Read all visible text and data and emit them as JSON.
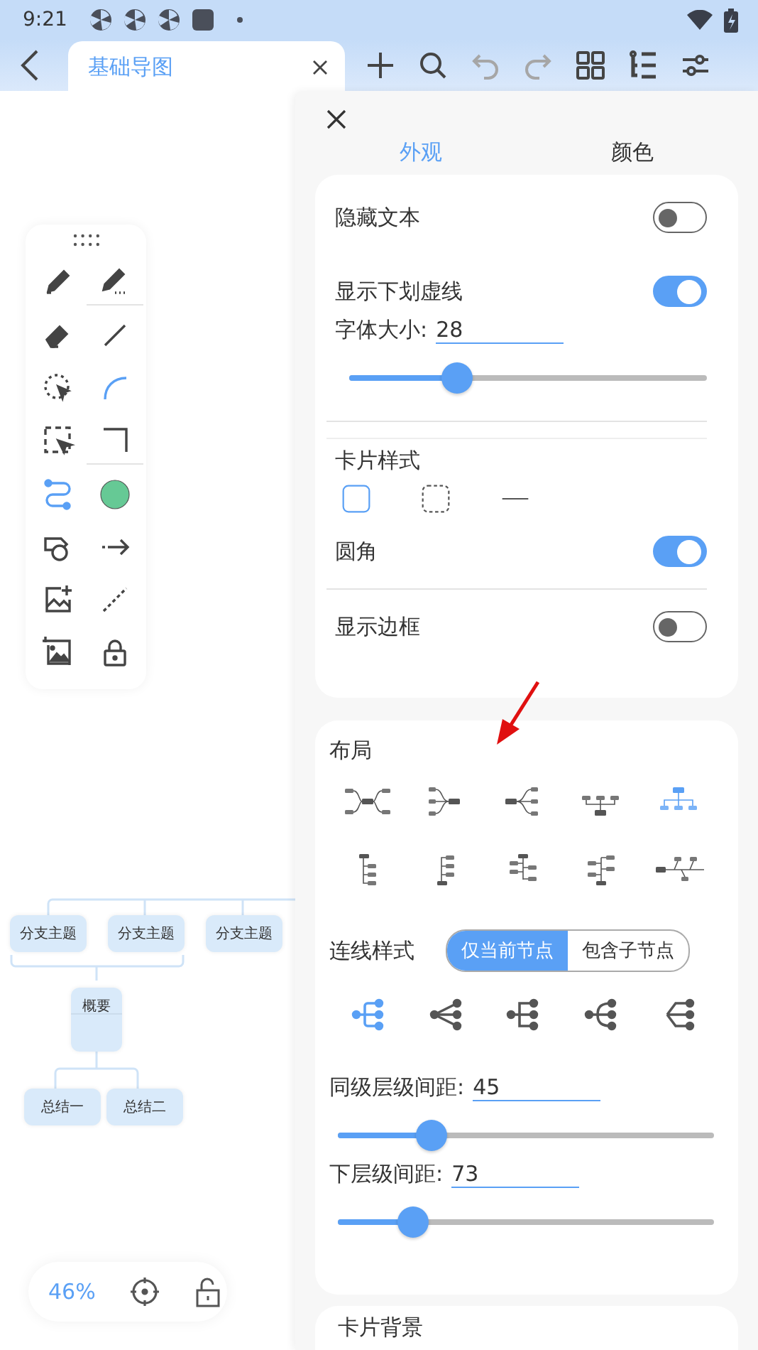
{
  "status_bar": {
    "time": "9:21"
  },
  "header": {
    "tab": {
      "label": "基础导图"
    },
    "toolbar": [
      {
        "kind": "add",
        "disabled": false
      },
      {
        "kind": "search",
        "disabled": false
      },
      {
        "kind": "undo",
        "disabled": true
      },
      {
        "kind": "redo",
        "disabled": true
      },
      {
        "kind": "grid",
        "disabled": false
      },
      {
        "kind": "outline",
        "disabled": false
      },
      {
        "kind": "settings",
        "disabled": false
      }
    ]
  },
  "palette": [
    {
      "kind": "pen",
      "selected": false
    },
    {
      "kind": "marker",
      "selected": false
    },
    {
      "kind": "eraser",
      "selected": false
    },
    {
      "kind": "line",
      "selected": false
    },
    {
      "kind": "lasso",
      "selected": false
    },
    {
      "kind": "curve",
      "selected": true
    },
    {
      "kind": "select",
      "selected": false
    },
    {
      "kind": "elbow",
      "selected": false
    },
    {
      "kind": "connector",
      "selected": true
    },
    {
      "kind": "color",
      "color": "#66c995"
    },
    {
      "kind": "shapes",
      "selected": false
    },
    {
      "kind": "arrow",
      "selected": false
    },
    {
      "kind": "image-add",
      "selected": false
    },
    {
      "kind": "dashed",
      "selected": false
    },
    {
      "kind": "image-crop",
      "selected": false
    },
    {
      "kind": "lock",
      "selected": false
    }
  ],
  "mindmap": {
    "branches": [
      "分支主题",
      "分支主题",
      "分支主题"
    ],
    "summary": "概要",
    "conclusions": [
      "总结一",
      "总结二"
    ]
  },
  "zoom": {
    "value": "46%"
  },
  "panel": {
    "tabs": [
      {
        "label": "外观",
        "selected": true
      },
      {
        "label": "颜色",
        "selected": false
      }
    ],
    "hide_text": {
      "label": "隐藏文本",
      "on": false
    },
    "dashed_underline": {
      "label": "显示下划虚线",
      "on": true
    },
    "font_size": {
      "label": "字体大小:",
      "value": "28",
      "level": 0.3
    },
    "card_style": {
      "label": "卡片样式",
      "options": [
        {
          "kind": "solid",
          "selected": true
        },
        {
          "kind": "dashed",
          "selected": false
        },
        {
          "kind": "line",
          "selected": false
        }
      ]
    },
    "rounded": {
      "label": "圆角",
      "on": true
    },
    "show_border": {
      "label": "显示边框",
      "on": false
    },
    "layout": {
      "label": "布局",
      "options": [
        {
          "kind": "both",
          "selected": false
        },
        {
          "kind": "left",
          "selected": false
        },
        {
          "kind": "right",
          "selected": false
        },
        {
          "kind": "org-up",
          "selected": false
        },
        {
          "kind": "org-down",
          "selected": true
        },
        {
          "kind": "tree-down",
          "selected": false
        },
        {
          "kind": "tree-up",
          "selected": false
        },
        {
          "kind": "tree-both-down",
          "selected": false
        },
        {
          "kind": "tree-both-up",
          "selected": false
        },
        {
          "kind": "fishbone",
          "selected": false
        }
      ]
    },
    "line_style": {
      "label": "连线样式",
      "scope": [
        {
          "label": "仅当前节点",
          "selected": true
        },
        {
          "label": "包含子节点",
          "selected": false
        }
      ],
      "options": [
        {
          "kind": "elbow",
          "selected": true
        },
        {
          "kind": "straight",
          "selected": false
        },
        {
          "kind": "square",
          "selected": false
        },
        {
          "kind": "round",
          "selected": false
        },
        {
          "kind": "bracket",
          "selected": false
        }
      ]
    },
    "sibling_spacing": {
      "label": "同级层级间距:",
      "value": "45",
      "level": 0.25
    },
    "level_spacing": {
      "label": "下层级间距:",
      "value": "73",
      "level": 0.2
    },
    "next_section": {
      "label": "卡片背景"
    }
  }
}
